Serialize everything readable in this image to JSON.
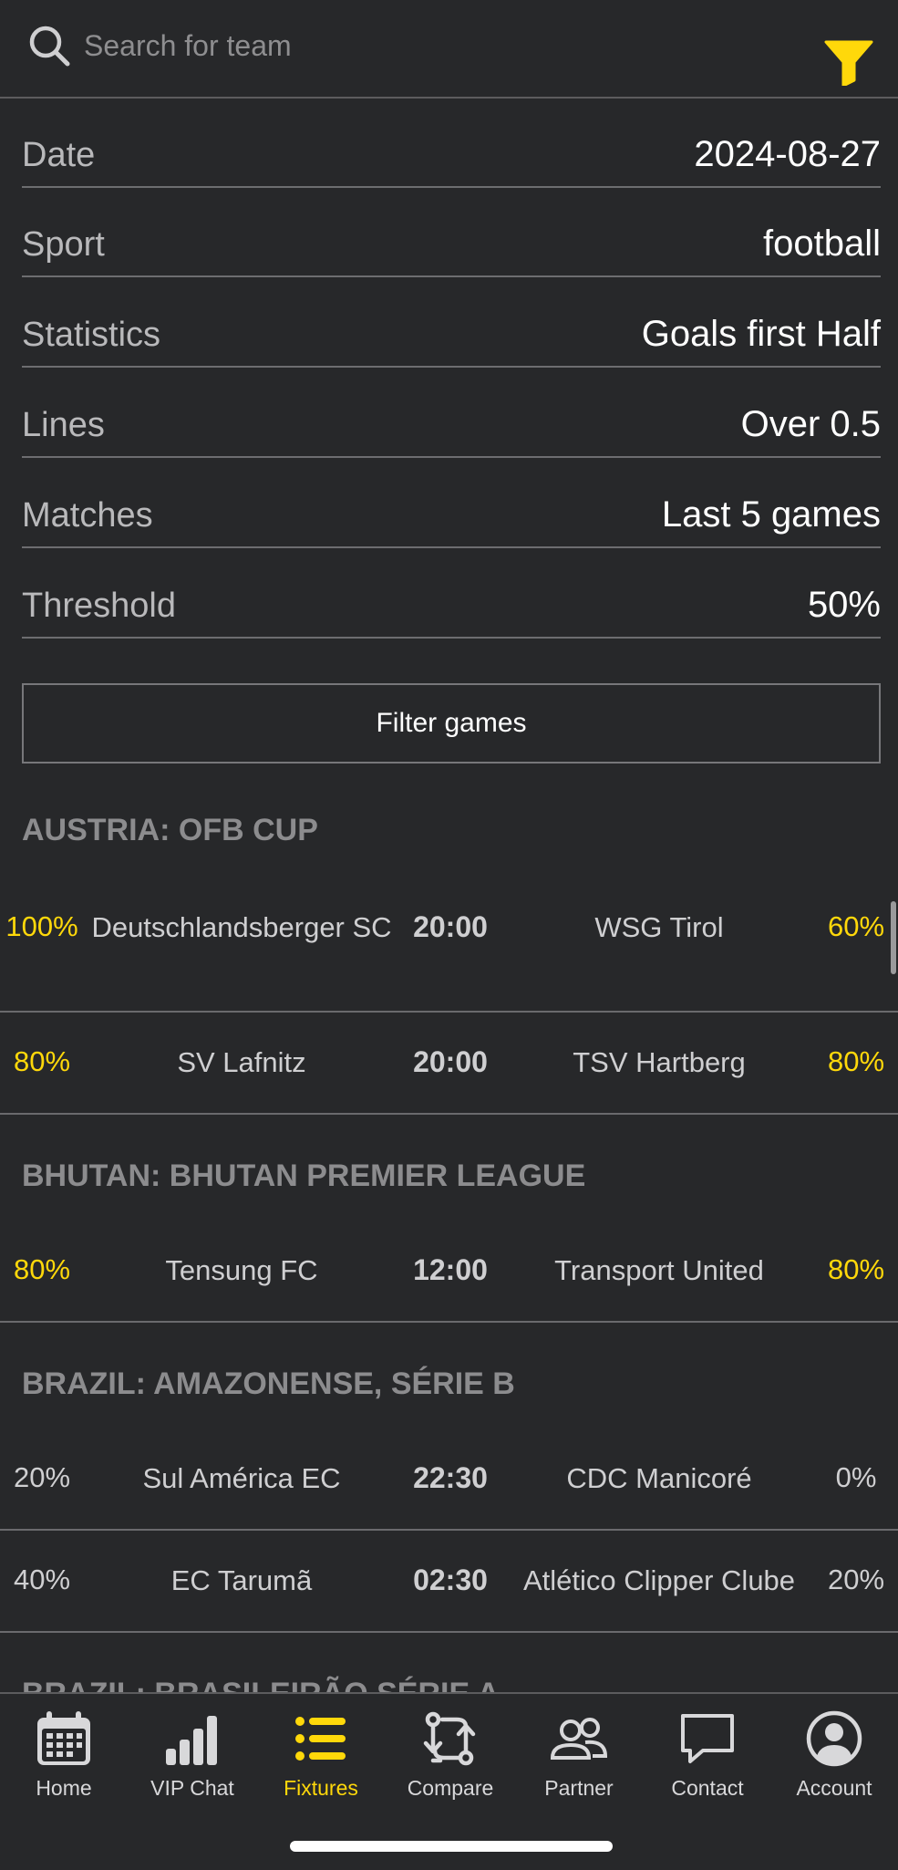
{
  "colors": {
    "background": "#27282a",
    "accent": "#ffd80a",
    "divider": "#6a6a6d"
  },
  "search": {
    "placeholder": "Search for team",
    "icon": "search-icon"
  },
  "filter_icon": "funnel-icon",
  "settings": [
    {
      "label": "Date",
      "value": "2024-08-27"
    },
    {
      "label": "Sport",
      "value": "football"
    },
    {
      "label": "Statistics",
      "value": "Goals first Half"
    },
    {
      "label": "Lines",
      "value": "Over 0.5"
    },
    {
      "label": "Matches",
      "value": "Last 5 games"
    },
    {
      "label": "Threshold",
      "value": "50%"
    }
  ],
  "filter_button": {
    "label": "Filter games"
  },
  "leagues": [
    {
      "title": "AUSTRIA: OFB CUP",
      "matches": [
        {
          "home_pct": "100%",
          "home_team": "Deutschlandsberger SC",
          "time": "20:00",
          "away_team": "WSG Tirol",
          "away_pct": "60%",
          "home_highlight": true,
          "away_highlight": true
        },
        {
          "home_pct": "80%",
          "home_team": "SV Lafnitz",
          "time": "20:00",
          "away_team": "TSV Hartberg",
          "away_pct": "80%",
          "home_highlight": true,
          "away_highlight": true
        }
      ]
    },
    {
      "title": "BHUTAN: BHUTAN PREMIER LEAGUE",
      "matches": [
        {
          "home_pct": "80%",
          "home_team": "Tensung FC",
          "time": "12:00",
          "away_team": "Transport United",
          "away_pct": "80%",
          "home_highlight": true,
          "away_highlight": true
        }
      ]
    },
    {
      "title": "BRAZIL: AMAZONENSE, SÉRIE B",
      "matches": [
        {
          "home_pct": "20%",
          "home_team": "Sul América EC",
          "time": "22:30",
          "away_team": "CDC Manicoré",
          "away_pct": "0%",
          "home_highlight": false,
          "away_highlight": false
        },
        {
          "home_pct": "40%",
          "home_team": "EC Tarumã",
          "time": "02:30",
          "away_team": "Atlético Clipper Clube",
          "away_pct": "20%",
          "home_highlight": false,
          "away_highlight": false
        }
      ]
    },
    {
      "title": "BRAZIL: BRASILEIRÃO SÉRIE A",
      "matches": []
    }
  ],
  "nav": {
    "active": "Fixtures",
    "items": [
      {
        "label": "Home",
        "icon": "calendar-icon"
      },
      {
        "label": "VIP Chat",
        "icon": "signal-bars-icon"
      },
      {
        "label": "Fixtures",
        "icon": "list-icon"
      },
      {
        "label": "Compare",
        "icon": "compare-arrows-icon"
      },
      {
        "label": "Partner",
        "icon": "people-icon"
      },
      {
        "label": "Contact",
        "icon": "chat-bubble-icon"
      },
      {
        "label": "Account",
        "icon": "account-icon"
      }
    ]
  }
}
